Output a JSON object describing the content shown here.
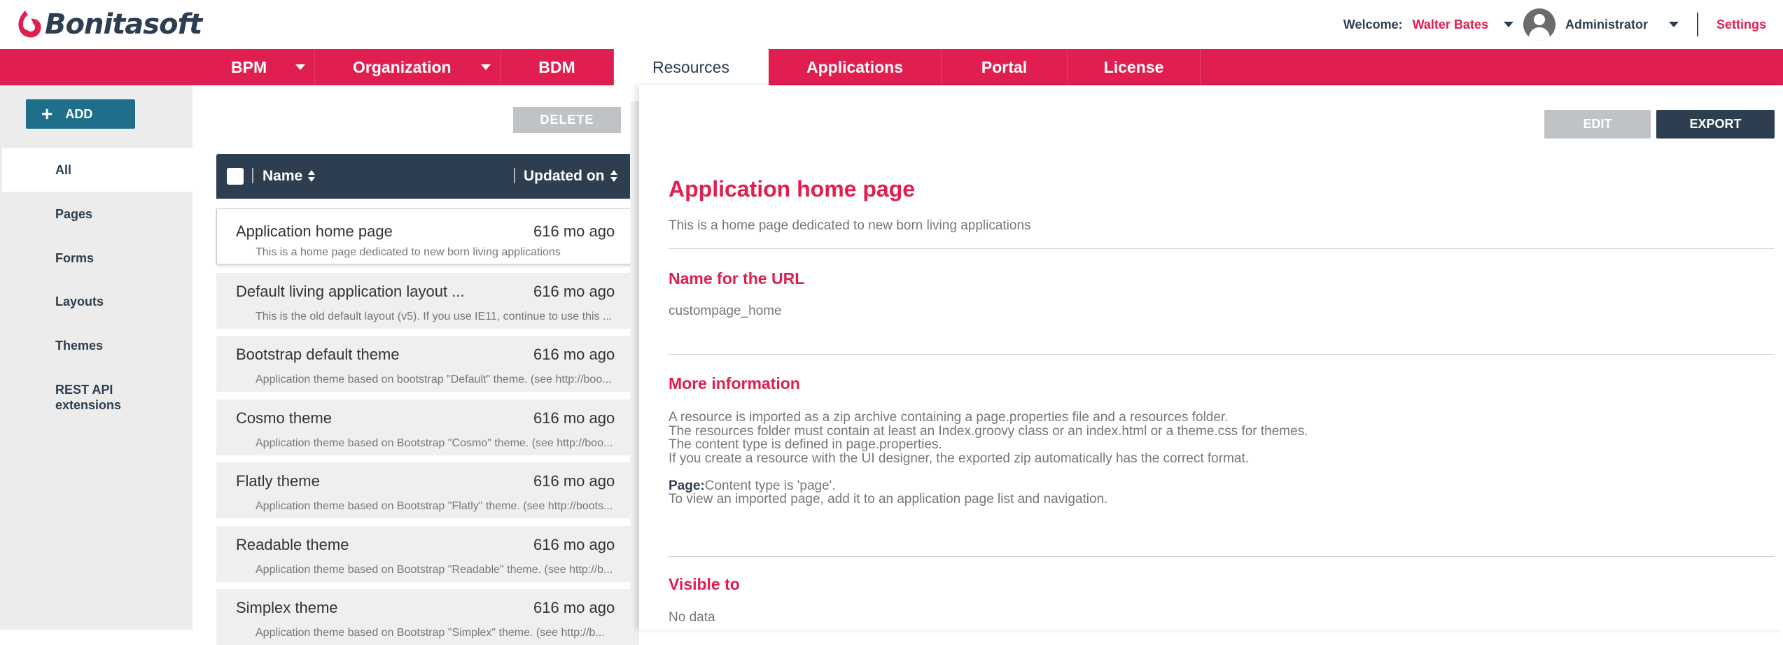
{
  "header": {
    "logo_text": "Bonitasoft",
    "welcome_label": "Welcome:",
    "user_name": "Walter Bates",
    "role": "Administrator",
    "settings_label": "Settings"
  },
  "menu": {
    "items": [
      {
        "label": "BPM",
        "has_caret": true
      },
      {
        "label": "Organization",
        "has_caret": true
      },
      {
        "label": "BDM",
        "has_caret": false
      },
      {
        "label": "Resources",
        "has_caret": false,
        "active": true
      },
      {
        "label": "Applications",
        "has_caret": false
      },
      {
        "label": "Portal",
        "has_caret": false
      },
      {
        "label": "License",
        "has_caret": false
      }
    ]
  },
  "sidebar": {
    "add_label": "ADD",
    "items": [
      {
        "label": "All",
        "active": true
      },
      {
        "label": "Pages"
      },
      {
        "label": "Forms"
      },
      {
        "label": "Layouts"
      },
      {
        "label": "Themes"
      },
      {
        "label": "REST API extensions"
      }
    ]
  },
  "list": {
    "delete_label": "DELETE",
    "columns": [
      "Name",
      "Updated on"
    ],
    "rows": [
      {
        "name": "Application home page",
        "updated": "616 mo ago",
        "description": "This is a home page dedicated to new born living applications",
        "selected": true
      },
      {
        "name": "Default living application layout ...",
        "updated": "616 mo ago",
        "description": "This is the old default layout (v5). If you use IE11, continue to use this ..."
      },
      {
        "name": "Bootstrap default theme",
        "updated": "616 mo ago",
        "description": "Application theme based on bootstrap \"Default\" theme. (see http://boo..."
      },
      {
        "name": "Cosmo theme",
        "updated": "616 mo ago",
        "description": "Application theme based on Bootstrap \"Cosmo\" theme. (see http://boo..."
      },
      {
        "name": "Flatly theme",
        "updated": "616 mo ago",
        "description": "Application theme based on Bootstrap \"Flatly\" theme. (see http://boots..."
      },
      {
        "name": "Readable theme",
        "updated": "616 mo ago",
        "description": "Application theme based on Bootstrap \"Readable\" theme. (see http://b..."
      },
      {
        "name": "Simplex theme",
        "updated": "616 mo ago",
        "description": "Application theme based on Bootstrap \"Simplex\" theme. (see http://b..."
      }
    ]
  },
  "detail": {
    "edit_label": "EDIT",
    "export_label": "EXPORT",
    "title": "Application home page",
    "description": "This is a home page dedicated to new born living applications",
    "url_heading": "Name for the URL",
    "url_value": "custompage_home",
    "more_heading": "More information",
    "more_lines": [
      "A resource is imported as a zip archive containing a page.properties file and a resources folder.",
      "The resources folder must contain at least an Index.groovy class or an index.html or a theme.css for themes.",
      "The content type is defined in page.properties.",
      "If you create a resource with the UI designer, the exported zip automatically has the correct format."
    ],
    "page_label": "Page:",
    "page_text": "Content type is 'page'.",
    "page_line2": "To view an imported page, add it to an application page list and navigation.",
    "visible_heading": "Visible to",
    "visible_value": "No data"
  },
  "colors": {
    "brand_red": "#e01e4f",
    "dark_navy": "#2c3e50",
    "add_blue": "#1f6f8b"
  }
}
